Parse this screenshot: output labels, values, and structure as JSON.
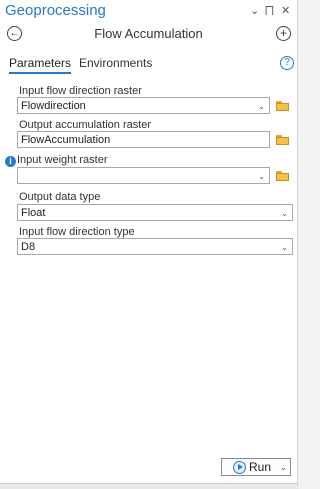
{
  "pane": {
    "title": "Geoprocessing",
    "menu_icon": "⌄",
    "pin_icon": "⨅",
    "close_icon": "✕"
  },
  "header": {
    "back_icon": "←",
    "tool_title": "Flow Accumulation",
    "add_icon": "+"
  },
  "tabs": [
    {
      "label": "Parameters",
      "active": true
    },
    {
      "label": "Environments",
      "active": false
    }
  ],
  "help_icon": "?",
  "parameters": {
    "input_flow_direction_raster": {
      "label": "Input flow direction raster",
      "value": "Flowdirection"
    },
    "output_accumulation_raster": {
      "label": "Output accumulation raster",
      "value": "FlowAccumulation"
    },
    "input_weight_raster": {
      "label": "Input weight raster",
      "value": ""
    },
    "output_data_type": {
      "label": "Output data type",
      "value": "Float"
    },
    "input_flow_direction_type": {
      "label": "Input flow direction type",
      "value": "D8"
    }
  },
  "info_icon": "i",
  "dropdown_arrow": "⌄",
  "run": {
    "label": "Run",
    "arrow": "⌄"
  },
  "colors": {
    "accent": "#2b78c5",
    "folder": "#f2c14e"
  }
}
